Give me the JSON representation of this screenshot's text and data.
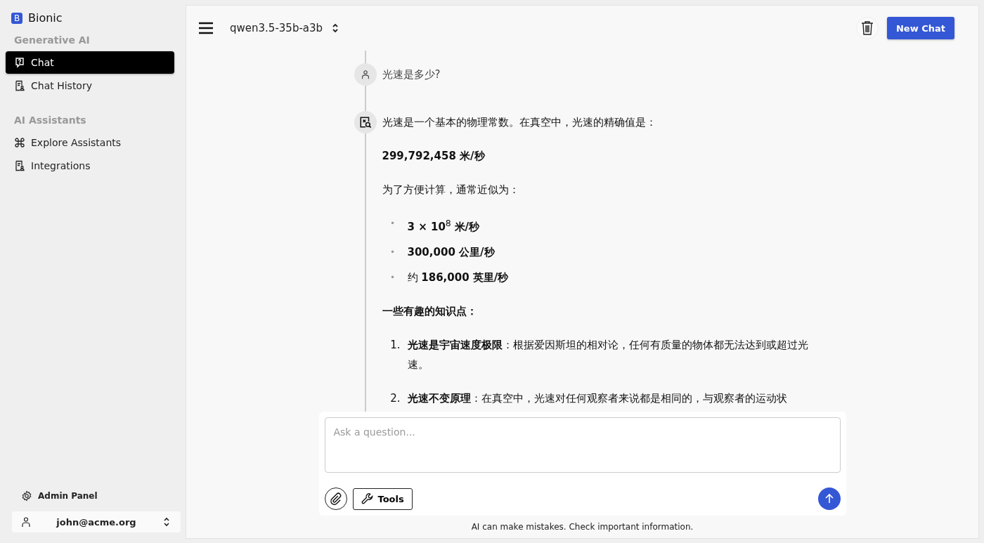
{
  "sidebar": {
    "brand": {
      "logo": "B",
      "name": "Bionic"
    },
    "sections": [
      {
        "title": "Generative AI",
        "items": [
          {
            "label": "Chat",
            "selected": true
          },
          {
            "label": "Chat History",
            "selected": false
          }
        ]
      },
      {
        "title": "AI Assistants",
        "items": [
          {
            "label": "Explore Assistants",
            "selected": false
          },
          {
            "label": "Integrations",
            "selected": false
          }
        ]
      }
    ],
    "admin": "Admin Panel",
    "user": "john@acme.org"
  },
  "header": {
    "model": "qwen3.5-35b-a3b",
    "new_chat": "New Chat"
  },
  "messages": [
    {
      "blocks": [
        {
          "kind": "paragraph",
          "text": "光速是多少?"
        }
      ]
    },
    {
      "blocks": [
        {
          "kind": "paragraph",
          "text": "光速是一个基本的物理常数。在真空中，光速的精确值是："
        },
        {
          "kind": "strong",
          "text": "299,792,458 米/秒"
        },
        {
          "kind": "paragraph",
          "text": "为了方便计算，通常近似为："
        },
        {
          "kind": "bullets",
          "items": [
            {
              "marker": "•",
              "text": "**3 × 10**$^{8}$ **米/秒**"
            },
            {
              "marker": "•",
              "text": "**300,000 公里/秒**"
            },
            {
              "marker": "•",
              "text": "约 **186,000 英里/秒**"
            }
          ]
        },
        {
          "kind": "strong",
          "text": "一些有趣的知识点："
        },
        {
          "kind": "numbered",
          "items": [
            {
              "marker": "1.",
              "text": "**光速是宇宙速度极限**：根据爱因斯坦的相对论，任何有质量的物体都无法达到或超过光速。"
            },
            {
              "marker": "2.",
              "text": "**光速不变原理**：在真空中，光速对任何观察者来说都是相同的，与观察者的运动状"
            }
          ]
        }
      ]
    }
  ],
  "composer": {
    "placeholder": "Ask a question...",
    "tools": "Tools"
  },
  "footer": "AI can make mistakes. Check important information."
}
